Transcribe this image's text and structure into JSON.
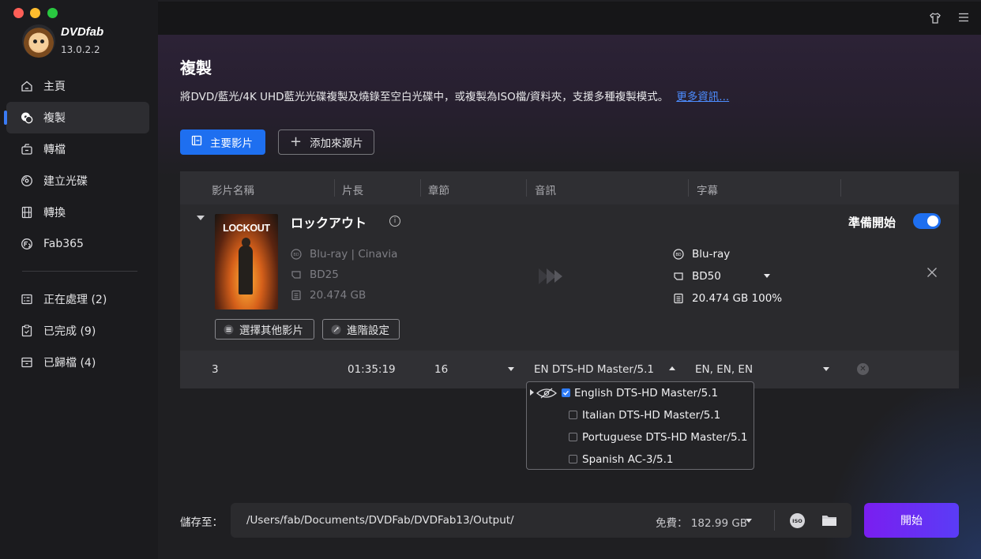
{
  "app": {
    "brand": "DVDfab",
    "version": "13.0.2.2"
  },
  "sidebar": {
    "items": [
      {
        "label": "主頁",
        "icon": "home-icon"
      },
      {
        "label": "複製",
        "icon": "copy-disc-icon",
        "active": true
      },
      {
        "label": "轉檔",
        "icon": "convert-icon"
      },
      {
        "label": "建立光碟",
        "icon": "create-disc-icon"
      },
      {
        "label": "轉換",
        "icon": "film-icon"
      },
      {
        "label": "Fab365",
        "icon": "fab365-icon"
      }
    ],
    "queue": [
      {
        "label": "正在處理 (2)",
        "icon": "processing-icon"
      },
      {
        "label": "已完成 (9)",
        "icon": "completed-icon"
      },
      {
        "label": "已歸檔 (4)",
        "icon": "archive-icon"
      }
    ]
  },
  "page": {
    "title": "複製",
    "description": "將DVD/藍光/4K UHD藍光光碟複製及燒錄至空白光碟中，或複製為ISO檔/資料夾，支援多種複製模式。",
    "more_link": "更多資訊..."
  },
  "toolbar": {
    "main_movie": "主要影片",
    "add_source": "添加來源片"
  },
  "table": {
    "headers": [
      "影片名稱",
      "片長",
      "章節",
      "音訊",
      "字幕"
    ]
  },
  "movie": {
    "title": "ロックアウト",
    "poster_text": "LOCKOUT",
    "source": {
      "format": "Blu-ray | Cinavia",
      "disc": "BD25",
      "size": "20.474 GB"
    },
    "output": {
      "format": "Blu-ray",
      "disc": "BD50",
      "size": "20.474 GB 100%"
    },
    "ready_label": "準備開始",
    "ready_enabled": true,
    "buttons": {
      "other_title": "選擇其他影片",
      "advanced": "進階設定"
    },
    "track": {
      "title_no": "3",
      "duration": "01:35:19",
      "chapters": "16",
      "audio": "EN  DTS-HD Master/5.1",
      "subtitles": "EN, EN, EN"
    }
  },
  "audio_options": [
    {
      "label": "English DTS-HD Master/5.1",
      "checked": true
    },
    {
      "label": "Italian DTS-HD Master/5.1",
      "checked": false
    },
    {
      "label": "Portuguese DTS-HD Master/5.1",
      "checked": false
    },
    {
      "label": "Spanish AC-3/5.1",
      "checked": false
    }
  ],
  "output": {
    "save_label": "儲存至：",
    "path": "/Users/fab/Documents/DVDFab/DVDFab13/Output/",
    "free_space": "免費： 182.99 GB",
    "iso_label": "ISO",
    "start_button": "開始"
  },
  "colors": {
    "accent_blue": "#1e6ff0",
    "start_purple": "#7a1ef0",
    "link": "#4d8dff"
  }
}
